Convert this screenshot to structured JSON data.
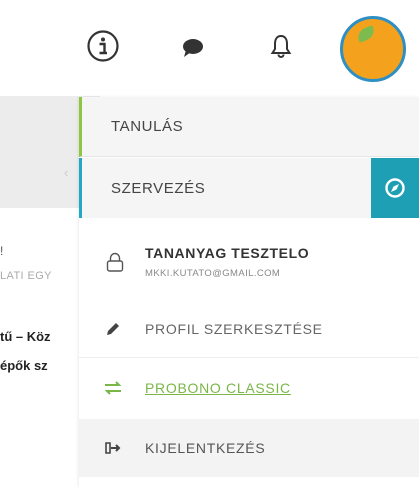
{
  "topbar": {
    "icons": [
      "info-icon",
      "chat-icon",
      "bell-icon"
    ],
    "avatar_colors": {
      "ring": "#2d8fc4",
      "fill": "#f4a21d"
    }
  },
  "background": {
    "exclaim": "!",
    "subtitle": "LATI EGY",
    "title_line1": "tű – Köz",
    "title_line2": "épők sz"
  },
  "menu": {
    "categories": [
      {
        "label": "TANULÁS",
        "accent": "#8dc63f"
      },
      {
        "label": "SZERVEZÉS",
        "accent": "#22a7c4",
        "side_icon": "compass-icon"
      }
    ],
    "user": {
      "name": "TANANYAG TESZTELO",
      "email": "MKKI.KUTATO@GMAIL.COM",
      "icon": "lock-icon"
    },
    "items": [
      {
        "label": "PROFIL SZERKESZTÉSE",
        "icon": "pencil-icon"
      },
      {
        "label": "PROBONO CLASSIC",
        "icon": "swap-arrows-icon",
        "color": "#7ab648"
      },
      {
        "label": "KIJELENTKEZÉS",
        "icon": "logout-icon"
      }
    ]
  }
}
